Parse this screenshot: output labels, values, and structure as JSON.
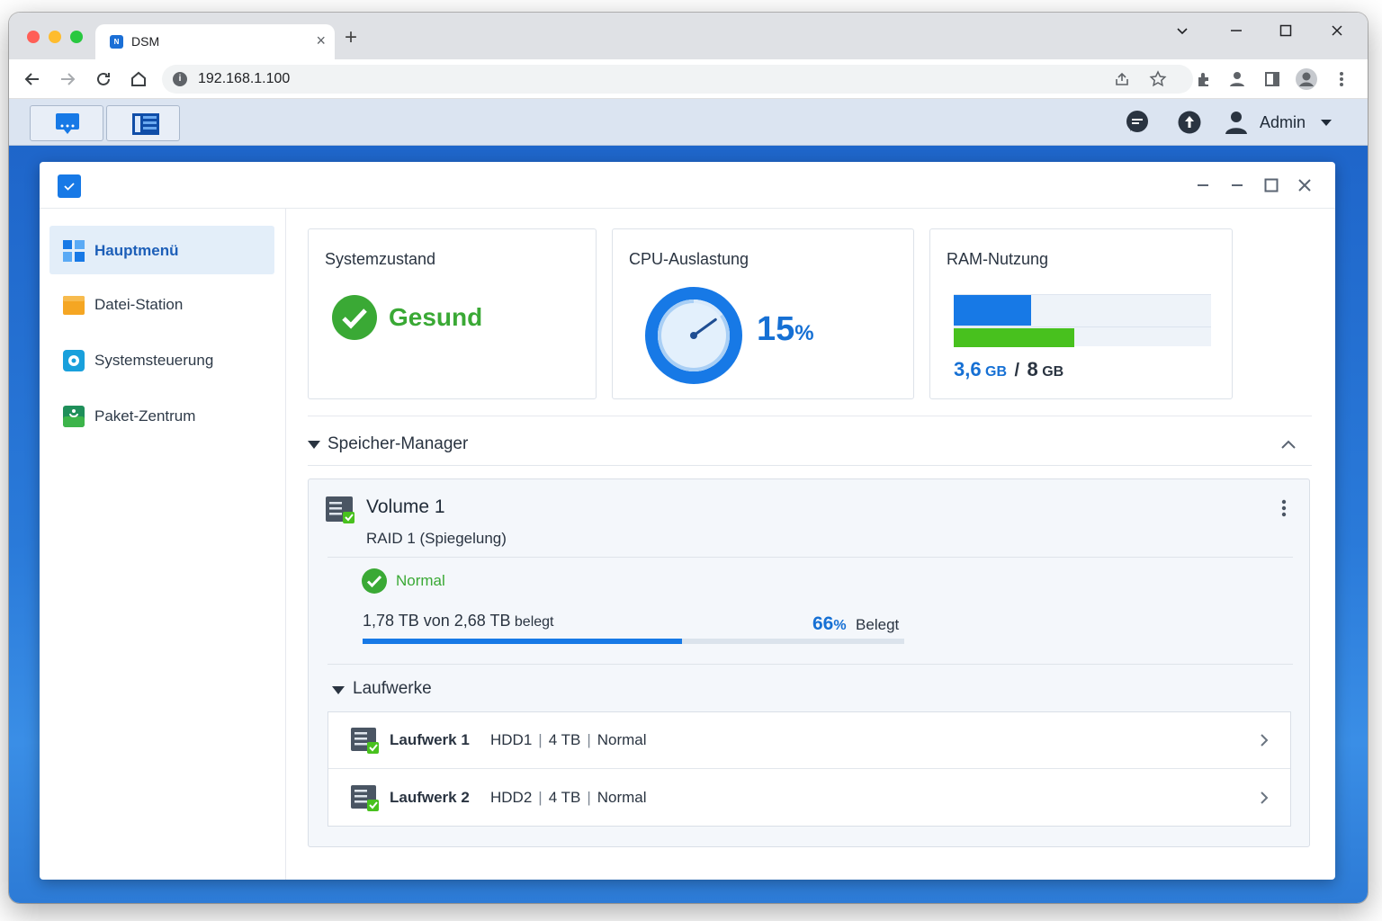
{
  "browser": {
    "tab_title": "DSM",
    "tab_favicon": "dsm-favicon",
    "url": "192.168.1.100"
  },
  "dsm_taskbar": {
    "user_label": "Admin"
  },
  "sidebar": {
    "items": [
      {
        "label": "Hauptmenü",
        "icon": "main-menu-icon",
        "color": "#1779e6"
      },
      {
        "label": "Datei-Station",
        "icon": "folder-icon",
        "color": "#f5a623"
      },
      {
        "label": "Systemsteuerung",
        "icon": "control-panel-icon",
        "color": "#19a0dc"
      },
      {
        "label": "Paket-Zentrum",
        "icon": "package-center-icon",
        "color": "#3cb44a"
      }
    ]
  },
  "widgets": {
    "system": {
      "title": "Systemzustand",
      "status": "Gesund",
      "status_color": "#3aa935"
    },
    "cpu": {
      "title": "CPU-Auslastung",
      "value": "15",
      "unit": "%",
      "usage_fraction": 0.15
    },
    "ram": {
      "title": "RAM-Nutzung",
      "used": "3,6",
      "used_unit": "GB",
      "slash": "/",
      "total": "8",
      "total_unit": "GB",
      "blue_bar_fraction": 0.3,
      "green_bar_fraction": 0.47
    }
  },
  "storage": {
    "section_title": "Speicher-Manager",
    "volume": {
      "name": "Volume 1",
      "raid": "RAID 1 (Spiegelung)",
      "status": "Normal",
      "usage_text": "1,78 TB von 2,68 TB",
      "usage_suffix": "belegt",
      "percent": "66",
      "percent_unit": "%",
      "percent_label": "Belegt",
      "used_fraction": 0.59
    },
    "drives_title": "Laufwerke",
    "drives": [
      {
        "name": "Laufwerk 1",
        "slot": "HDD1",
        "size": "4 TB",
        "status": "Normal"
      },
      {
        "name": "Laufwerk 2",
        "slot": "HDD2",
        "size": "4 TB",
        "status": "Normal"
      }
    ]
  },
  "colors": {
    "accent": "#1779e6",
    "healthy": "#3aa935"
  }
}
